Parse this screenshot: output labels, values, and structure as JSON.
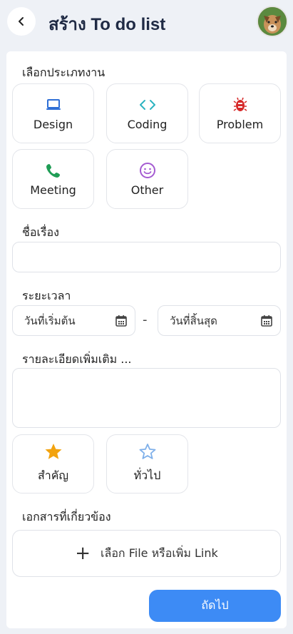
{
  "header": {
    "title": "สร้าง To do list"
  },
  "category": {
    "label": "เลือกประเภทงาน",
    "items": [
      {
        "label": "Design",
        "icon": "laptop-icon",
        "color": "#2f6fd6"
      },
      {
        "label": "Coding",
        "icon": "code-icon",
        "color": "#2bb3c0"
      },
      {
        "label": "Problem",
        "icon": "bug-icon",
        "color": "#d62a2a"
      },
      {
        "label": "Meeting",
        "icon": "phone-icon",
        "color": "#1f9d55"
      },
      {
        "label": "Other",
        "icon": "smile-icon",
        "color": "#a45bd1"
      }
    ]
  },
  "title_field": {
    "label": "ชื่อเรื่อง",
    "value": ""
  },
  "duration": {
    "label": "ระยะเวลา",
    "start_placeholder": "วันที่เริ่มต้น",
    "separator": "-",
    "end_placeholder": "วันที่สิ้นสุด"
  },
  "details": {
    "label": "รายละเอียดเพิ่มเติม ...",
    "value": ""
  },
  "priority": {
    "items": [
      {
        "label": "สำคัญ",
        "icon": "star-filled-icon",
        "color": "#f2a30f"
      },
      {
        "label": "ทั่วไป",
        "icon": "star-outline-icon",
        "color": "#7fb0ea"
      }
    ]
  },
  "attachments": {
    "label": "เอกสารที่เกี่ยวข้อง",
    "button_label": "เลือก File หรือเพิ่ม Link"
  },
  "actions": {
    "next_label": "ถัดไป",
    "accent": "#3d8bf5"
  }
}
